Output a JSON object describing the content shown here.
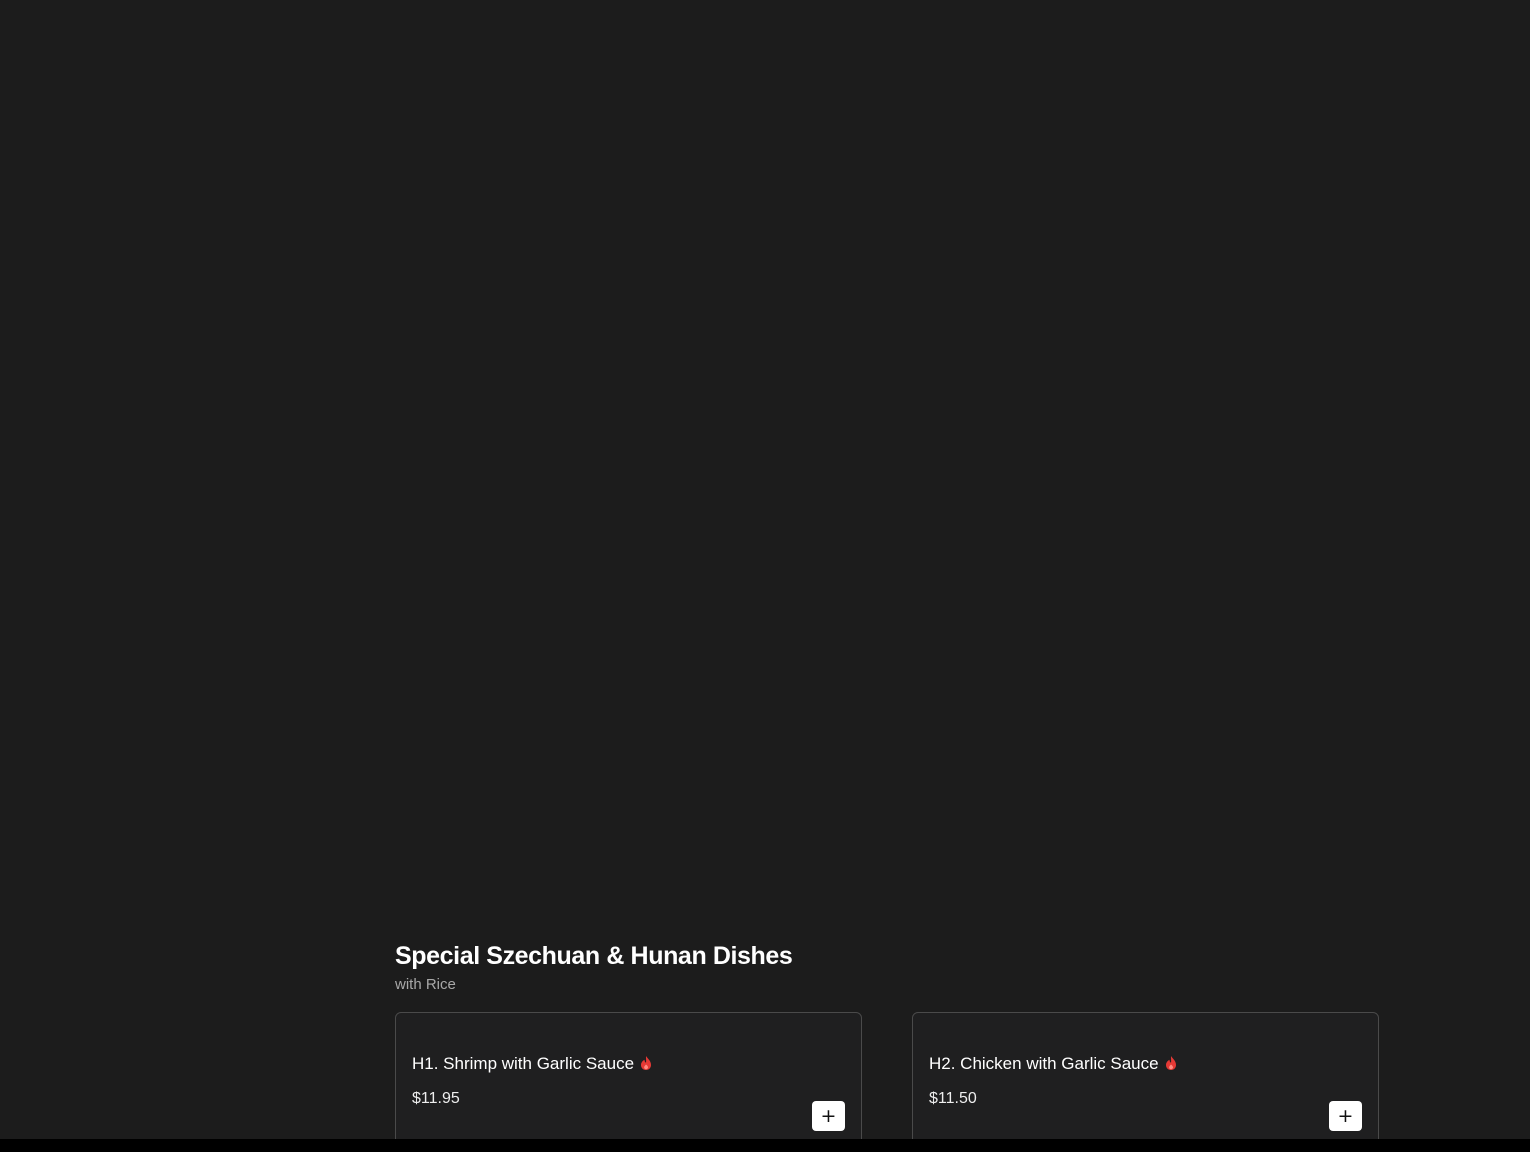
{
  "section": {
    "title": "Special Szechuan & Hunan Dishes",
    "subtitle": "with Rice"
  },
  "items": [
    {
      "name": "H1. Shrimp with Garlic Sauce",
      "price": "$11.95",
      "spicy_icon": "flame-icon",
      "add_label": "+"
    },
    {
      "name": "H2. Chicken with Garlic Sauce",
      "price": "$11.50",
      "spicy_icon": "flame-icon",
      "add_label": "+"
    }
  ],
  "colors": {
    "background": "#1c1c1c",
    "card_border": "#4a4a4a",
    "spicy": "#e53935",
    "button_bg": "#ffffff"
  }
}
